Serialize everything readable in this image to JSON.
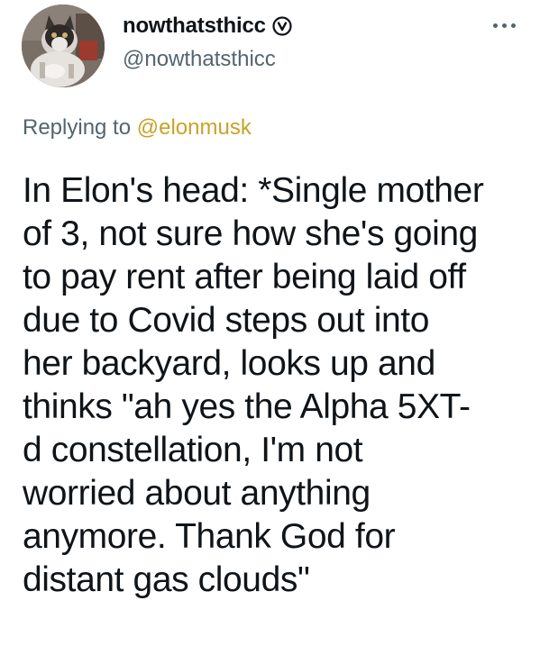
{
  "author": {
    "display_name": "nowthatsthicc",
    "handle": "@nowthatsthicc",
    "verified_icon": "verified-badge-icon",
    "avatar": "cat-photo-avatar"
  },
  "reply": {
    "prefix": "Replying to ",
    "mention": "@elonmusk"
  },
  "tweet": {
    "lines": [
      "In Elon's head: *Single mother",
      "of 3, not sure how she's going",
      "to pay rent after being laid off",
      "due to Covid steps out into",
      "her backyard, looks up and",
      "thinks \"ah yes the Alpha 5XT-",
      "d constellation, I'm not",
      "worried about anything",
      "anymore. Thank God for",
      "distant gas clouds\""
    ]
  },
  "more_icon": "more-options-icon",
  "colors": {
    "text": "#0f1419",
    "secondary": "#536471",
    "mention": "#c9a227"
  }
}
